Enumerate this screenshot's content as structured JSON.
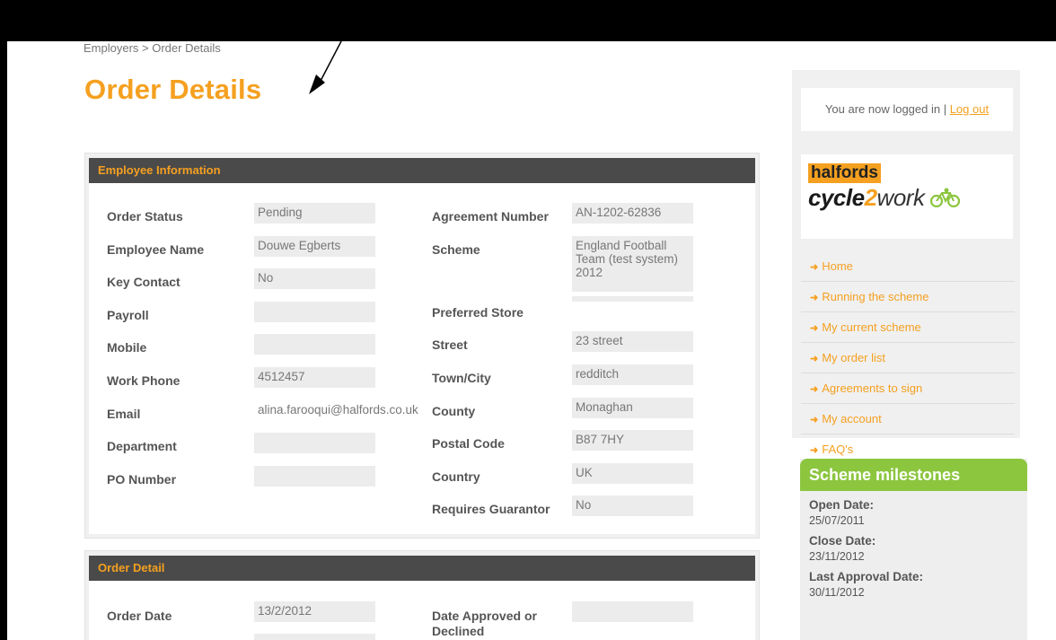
{
  "breadcrumb": "Employers > Order Details",
  "page_title": "Order Details",
  "employee_info": {
    "header": "Employee Information",
    "left": [
      {
        "label": "Order Status",
        "value": "Pending"
      },
      {
        "label": "Employee Name",
        "value": "Douwe Egberts"
      },
      {
        "label": "Key Contact",
        "value": "No"
      },
      {
        "label": "Payroll",
        "value": ""
      },
      {
        "label": "Mobile",
        "value": ""
      },
      {
        "label": "Work Phone",
        "value": "4512457"
      },
      {
        "label": "Email",
        "value": "alina.farooqui@halfords.co.uk"
      },
      {
        "label": "Department",
        "value": ""
      },
      {
        "label": "PO Number",
        "value": ""
      }
    ],
    "right": [
      {
        "label": "Agreement Number",
        "value": "AN-1202-62836"
      },
      {
        "label": "Scheme",
        "value": "England Football Team (test system) 2012"
      },
      {
        "label": "Preferred Store",
        "value": ""
      },
      {
        "label": "Street",
        "value": "23 street"
      },
      {
        "label": "Town/City",
        "value": "redditch"
      },
      {
        "label": "County",
        "value": "Monaghan"
      },
      {
        "label": "Postal Code",
        "value": "B87 7HY"
      },
      {
        "label": "Country",
        "value": "UK"
      },
      {
        "label": "Requires Guarantor",
        "value": "No"
      }
    ]
  },
  "order_detail": {
    "header": "Order Detail",
    "left": [
      {
        "label": "Order Date",
        "value": "13/2/2012"
      }
    ],
    "right": [
      {
        "label": "Date Approved or Declined",
        "value": ""
      }
    ]
  },
  "sidebar": {
    "login_text": "You are now logged in | ",
    "logout_label": "Log out",
    "logo_top": "halfords",
    "logo_cycle": "cycle",
    "logo_two": "2",
    "logo_work": "work",
    "nav": [
      "Home",
      "Running the scheme",
      "My current scheme",
      "My order list",
      "Agreements to sign",
      "My account",
      "FAQ's"
    ]
  },
  "milestones": {
    "title": "Scheme milestones",
    "items": [
      {
        "label": "Open Date:",
        "value": "25/07/2011"
      },
      {
        "label": "Close Date:",
        "value": "23/11/2012"
      },
      {
        "label": "Last Approval Date:",
        "value": "30/11/2012"
      }
    ]
  },
  "colors": {
    "accent": "#f5a020",
    "header_bg": "#4a4a4a",
    "green": "#8cc63f"
  }
}
